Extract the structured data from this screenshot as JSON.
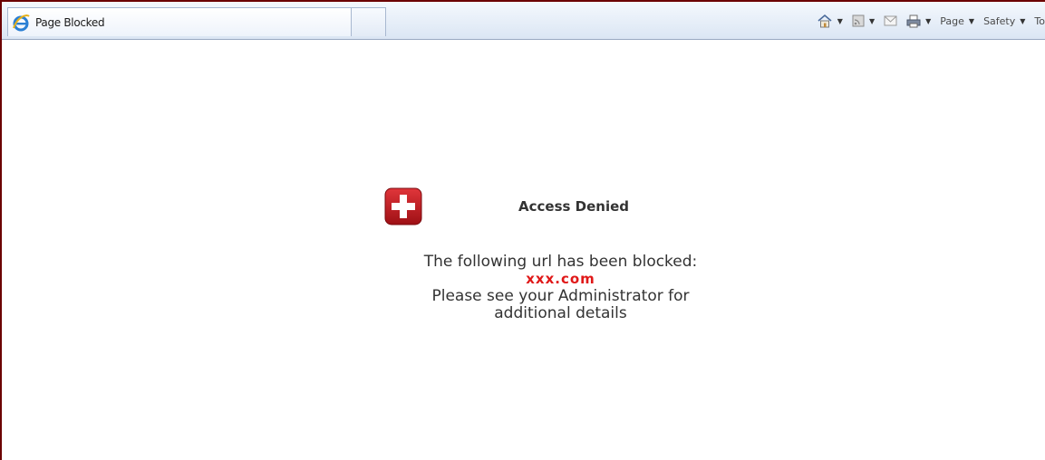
{
  "tab": {
    "title": "Page Blocked",
    "icon": "ie-logo-icon"
  },
  "command_bar": {
    "home_icon": "home-icon",
    "feeds_icon": "feeds-icon",
    "mail_icon": "mail-icon",
    "print_icon": "print-icon",
    "page_label": "Page",
    "safety_label": "Safety",
    "tools_label": "To"
  },
  "page": {
    "heading": "Access Denied",
    "icon": "blocked-cross-icon",
    "message_line1": "The following url has been blocked:",
    "blocked_url": "xxx.com",
    "message_line2": "Please see your Administrator for",
    "message_line3": "additional details"
  },
  "colors": {
    "url_red": "#e01818",
    "icon_red": "#c8161c",
    "frame_border": "#6b0000"
  }
}
